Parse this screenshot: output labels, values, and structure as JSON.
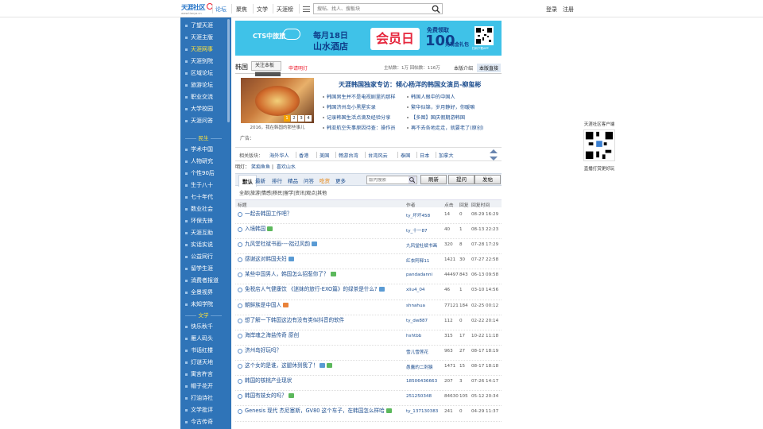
{
  "header": {
    "logo_text": "天涯社区",
    "logo_sub": "www.tianya.cn",
    "forum": "论坛",
    "nav": [
      "聚焦",
      "文学",
      "天涯榜"
    ],
    "search_placeholder": "搜帖、找人、搜板块",
    "login": "登录",
    "register": "注册"
  },
  "sidebar": {
    "top_items": [
      {
        "label": "了望天涯",
        "active": false
      },
      {
        "label": "天涯主版",
        "active": false
      },
      {
        "label": "天涯网事",
        "active": true
      },
      {
        "label": "天涯别院",
        "active": false
      },
      {
        "label": "区域论坛",
        "active": false
      },
      {
        "label": "旅游论坛",
        "active": false
      },
      {
        "label": "职业交流",
        "active": false
      },
      {
        "label": "大学校园",
        "active": false
      },
      {
        "label": "天涯问答",
        "active": false
      }
    ],
    "group1": "民生",
    "group1_items": [
      "学术中国",
      "人物研究",
      "个性90后",
      "生于八十",
      "七十年代",
      "数业社会",
      "环保先锋",
      "天涯互助",
      "实话实说",
      "公益同行",
      "留学生涯",
      "消费者报道",
      "全景视界",
      "未知学院"
    ],
    "group2": "文学",
    "group2_items": [
      "快乐秋千",
      "雁人码头",
      "书话红楼",
      "灯谜天地",
      "寓言杵言",
      "帽子花开",
      "打油诗社",
      "文学批评",
      "今古传奇"
    ]
  },
  "banner": {
    "brand": "CTS中旅旅",
    "line1": "每月18日",
    "line2": "山水酒店",
    "big": "会员日",
    "free": "免费领取",
    "amount": "100",
    "gift": "元现金礼包",
    "qr_caption": "扫码下载APP",
    "brand_color": "#3fc2e8"
  },
  "board": {
    "name": "韩国",
    "follow": "关注本板",
    "apply": "申请明灯",
    "stats": "主帖数：1万  回帖数：116万",
    "intro": "本版介绍",
    "direct": "本版直接"
  },
  "feature": {
    "caption": "2016，我在韩国的那些事儿",
    "pages": [
      "1",
      "2",
      "3",
      "4"
    ],
    "active_page": "1",
    "ad": "广告：",
    "headline": "天涯韩国独家专访：倾心杨洋的韩国女演员-柳玺彬",
    "links_left": [
      "韩国男生并不是电视剧里的那样",
      "韩国济州岛小黑屋实录",
      "记录韩国生活点滴及经验分享",
      "韩亚航空失事原因待查：操作员"
    ],
    "links_right": [
      "韩国人眼中的中国人",
      "繁华似锦，岁月静好，你暖嘛",
      "【多图】国庆假期游韩国",
      "再不去各地走走，就要老了(原创)"
    ]
  },
  "related": {
    "label": "相关版块：",
    "items": [
      "海外华人",
      "香港",
      "美国",
      "畅游台湾",
      "台湾风云",
      "泰国",
      "日本",
      "加拿大"
    ]
  },
  "hot": {
    "label": "明灯：",
    "items": [
      "笑痴鱼鱼",
      "喜欢山水"
    ]
  },
  "tabs": {
    "items": [
      "默认",
      "最新",
      "排行",
      "精品",
      "问答",
      "吃货",
      "更多"
    ],
    "search_placeholder": "版内搜索",
    "refresh": "刷新",
    "ask": "提问",
    "post": "发帖"
  },
  "categories": "全部|旅游|情感|移民|留学|资讯|观点|其他",
  "table": {
    "headers": [
      "标题",
      "作者",
      "点击",
      "回复",
      "回复时间"
    ],
    "rows": [
      {
        "title": "一起去韩国工作吧？",
        "author": "ty_坏坏458",
        "clicks": "14",
        "replies": "0",
        "time": "08-29 16:29",
        "tag": ""
      },
      {
        "title": "入境韩国",
        "author": "ty_十一87",
        "clicks": "40",
        "replies": "1",
        "time": "08-13 22:23",
        "tag": "green"
      },
      {
        "title": "九风堂杜斌书画----拙过风韵",
        "author": "九风堂杜斌书画",
        "clicks": "320",
        "replies": "8",
        "time": "07-28 17:29",
        "tag": "blue"
      },
      {
        "title": "感谢这对韩国夫妇",
        "author": "红衣阿释11",
        "clicks": "1421",
        "replies": "30",
        "time": "07-27 22:58",
        "tag": "blue"
      },
      {
        "title": "某些中国男人，韩国怎么招惹你了？",
        "author": "pandadanni",
        "clicks": "44497",
        "replies": "843",
        "time": "06-13 09:58",
        "tag": "green"
      },
      {
        "title": "免税店人气健康饮 《迷妹的旅行-EXO篇》的绿茶是什么?",
        "author": "xliu4_04",
        "clicks": "46",
        "replies": "1",
        "time": "03-10 14:56",
        "tag": "blue"
      },
      {
        "title": "朝鲜族是中国人",
        "author": "shnahua",
        "clicks": "77121",
        "replies": "184",
        "time": "02-25 00:12",
        "tag": "orange"
      },
      {
        "title": "想了解一下韩国这边有没有类似抖音的软件",
        "author": "ty_dw887",
        "clicks": "112",
        "replies": "0",
        "time": "02-22 20:14",
        "tag": ""
      },
      {
        "title": "海岸魂之海盐传奇 原创",
        "author": "hshtbb",
        "clicks": "315",
        "replies": "17",
        "time": "10-22 11:18",
        "tag": ""
      },
      {
        "title": "济州岛好玩吗？",
        "author": "雪儿雪莲花",
        "clicks": "963",
        "replies": "27",
        "time": "08-17 18:19",
        "tag": ""
      },
      {
        "title": "这个女的是谁，这腿休到我了！",
        "author": "愚蠢的二刺猿",
        "clicks": "1471",
        "replies": "15",
        "time": "08-17 18:18",
        "tag": "bluegreen"
      },
      {
        "title": "韩国的核桃产业现状",
        "author": "18506436663",
        "clicks": "207",
        "replies": "3",
        "time": "07-26 14:17",
        "tag": ""
      },
      {
        "title": "韩国有妓女的吗？",
        "author": "251250348",
        "clicks": "84630",
        "replies": "105",
        "time": "05-12 20:34",
        "tag": "green"
      },
      {
        "title": "Genesis 现代 杰尼塞斯，GV80 这个车子，在韩国怎么样哈",
        "author": "ty_137130383",
        "clicks": "241",
        "replies": "0",
        "time": "04-29 11:37",
        "tag": "green"
      }
    ]
  },
  "side_qr": {
    "caption1": "天涯社区客户端",
    "caption2": "直播打赏更好玩"
  }
}
